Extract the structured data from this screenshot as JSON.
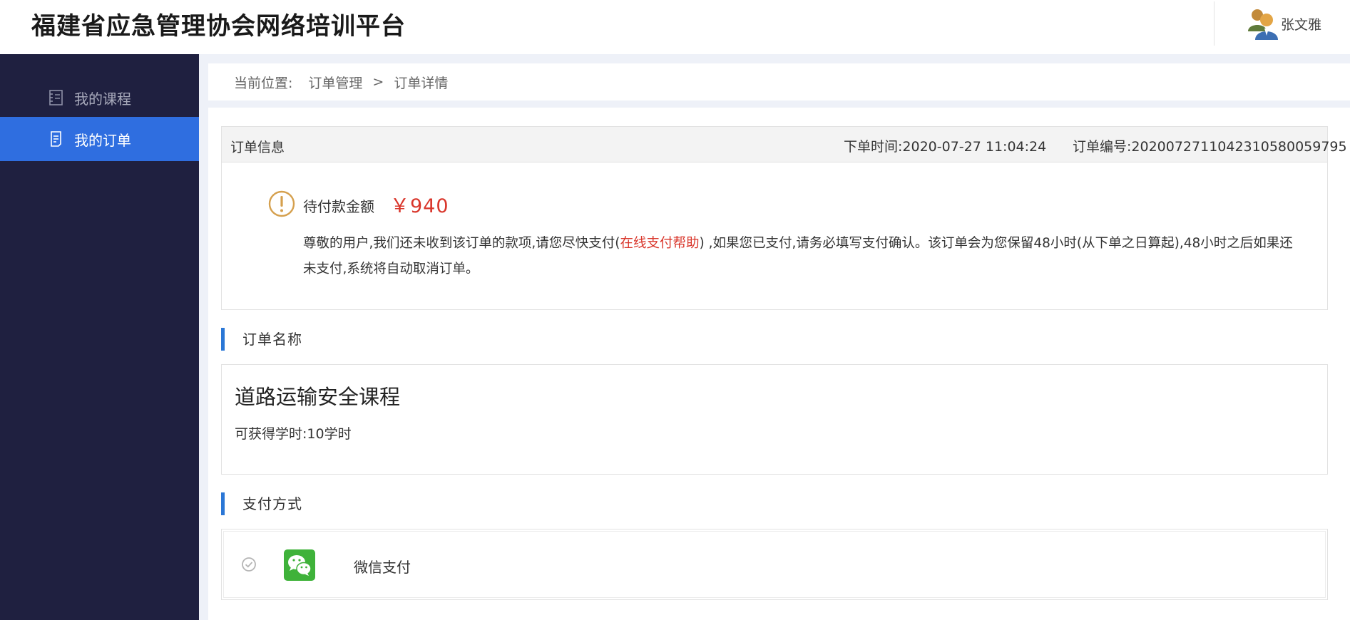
{
  "header": {
    "site_title": "福建省应急管理协会网络培训平台",
    "user_name": "张文雅",
    "avatar_icon": "user-group-avatar-icon"
  },
  "sidebar": {
    "items": [
      {
        "label": "我的课程",
        "icon": "course-book-icon",
        "active": false
      },
      {
        "label": "我的订单",
        "icon": "order-document-icon",
        "active": true
      }
    ],
    "active_color": "#2f6ee0",
    "background_color": "#1f2040"
  },
  "breadcrumb": {
    "prefix": "当前位置:",
    "items": [
      "订单管理",
      "订单详情"
    ],
    "separator": ">"
  },
  "order_info": {
    "title": "订单信息",
    "time": "下单时间:2020-07-27 11:04:24",
    "number": "订单编号:20200727110423105800597​95"
  },
  "payment_due": {
    "label": "待付款金额",
    "amount": "￥940",
    "notice_before": "尊敬的用户,我们还未收到该订单的款项,请您尽快支付(",
    "notice_link": "在线支付帮助",
    "notice_after": ") ,如果您已支付,请务必填写支付确认。该订单会为您保留48小时(从下单之日算起),48小时之后如果还未支付,系统将自动取消订单。",
    "amount_color": "#d9362b"
  },
  "order_name_section": {
    "heading": "订单名称",
    "course_name": "道路运输安全课程",
    "course_hours": "可获得学时:10学时"
  },
  "payment_method_section": {
    "heading": "支付方式",
    "methods": [
      {
        "label": "微信支付",
        "icon": "wechat-pay-icon",
        "selected": false
      }
    ]
  }
}
